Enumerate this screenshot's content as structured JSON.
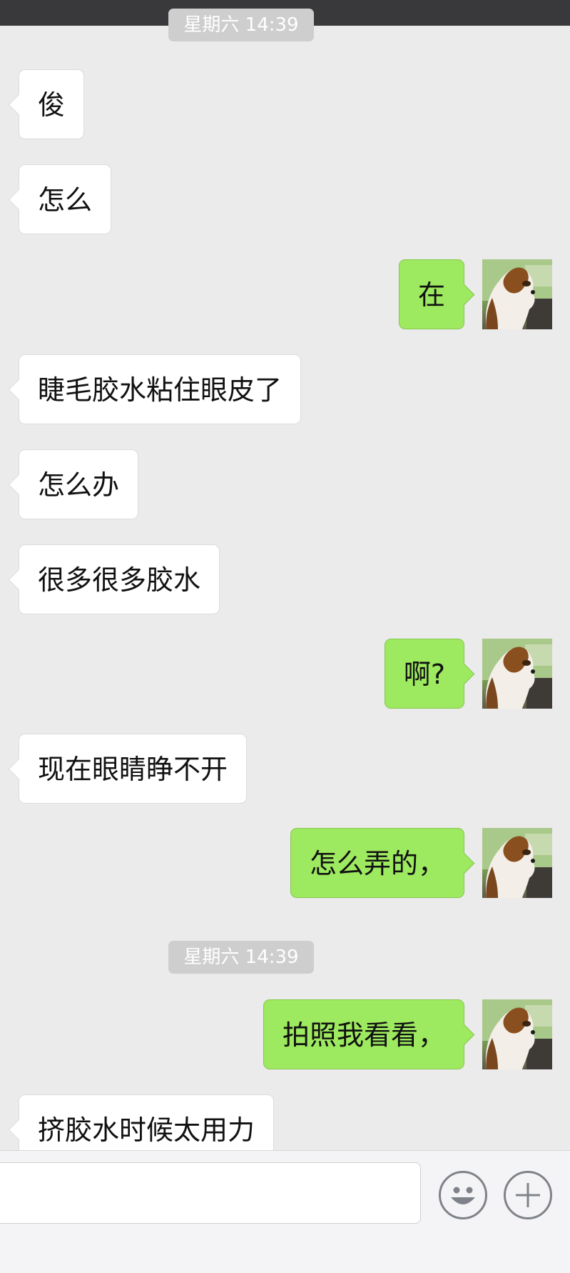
{
  "header": {
    "title": ""
  },
  "messages": [
    {
      "type": "timestamp",
      "text": "星期六 14:39"
    },
    {
      "type": "received",
      "text": "俊"
    },
    {
      "type": "received",
      "text": "怎么"
    },
    {
      "type": "sent",
      "text": "在"
    },
    {
      "type": "received",
      "text": "睫毛胶水粘住眼皮了"
    },
    {
      "type": "received",
      "text": "怎么办"
    },
    {
      "type": "received",
      "text": "很多很多胶水"
    },
    {
      "type": "sent",
      "text": "啊?"
    },
    {
      "type": "received",
      "text": "现在眼睛睁不开"
    },
    {
      "type": "sent",
      "text": "怎么弄的，"
    },
    {
      "type": "timestamp",
      "text": "星期六 14:39"
    },
    {
      "type": "sent",
      "text": "拍照我看看，"
    },
    {
      "type": "received",
      "text": "挤胶水时候太用力"
    }
  ],
  "avatar": {
    "icon": "collie-dog-avatar"
  },
  "input": {
    "value": "",
    "placeholder": ""
  },
  "toolbar": {
    "emoji_icon": "smiley-face-icon",
    "more_icon": "plus-circle-icon"
  },
  "colors": {
    "sent_bubble": "#9de95f",
    "received_bubble": "#ffffff",
    "background": "#ebebeb",
    "header": "#39393b"
  }
}
